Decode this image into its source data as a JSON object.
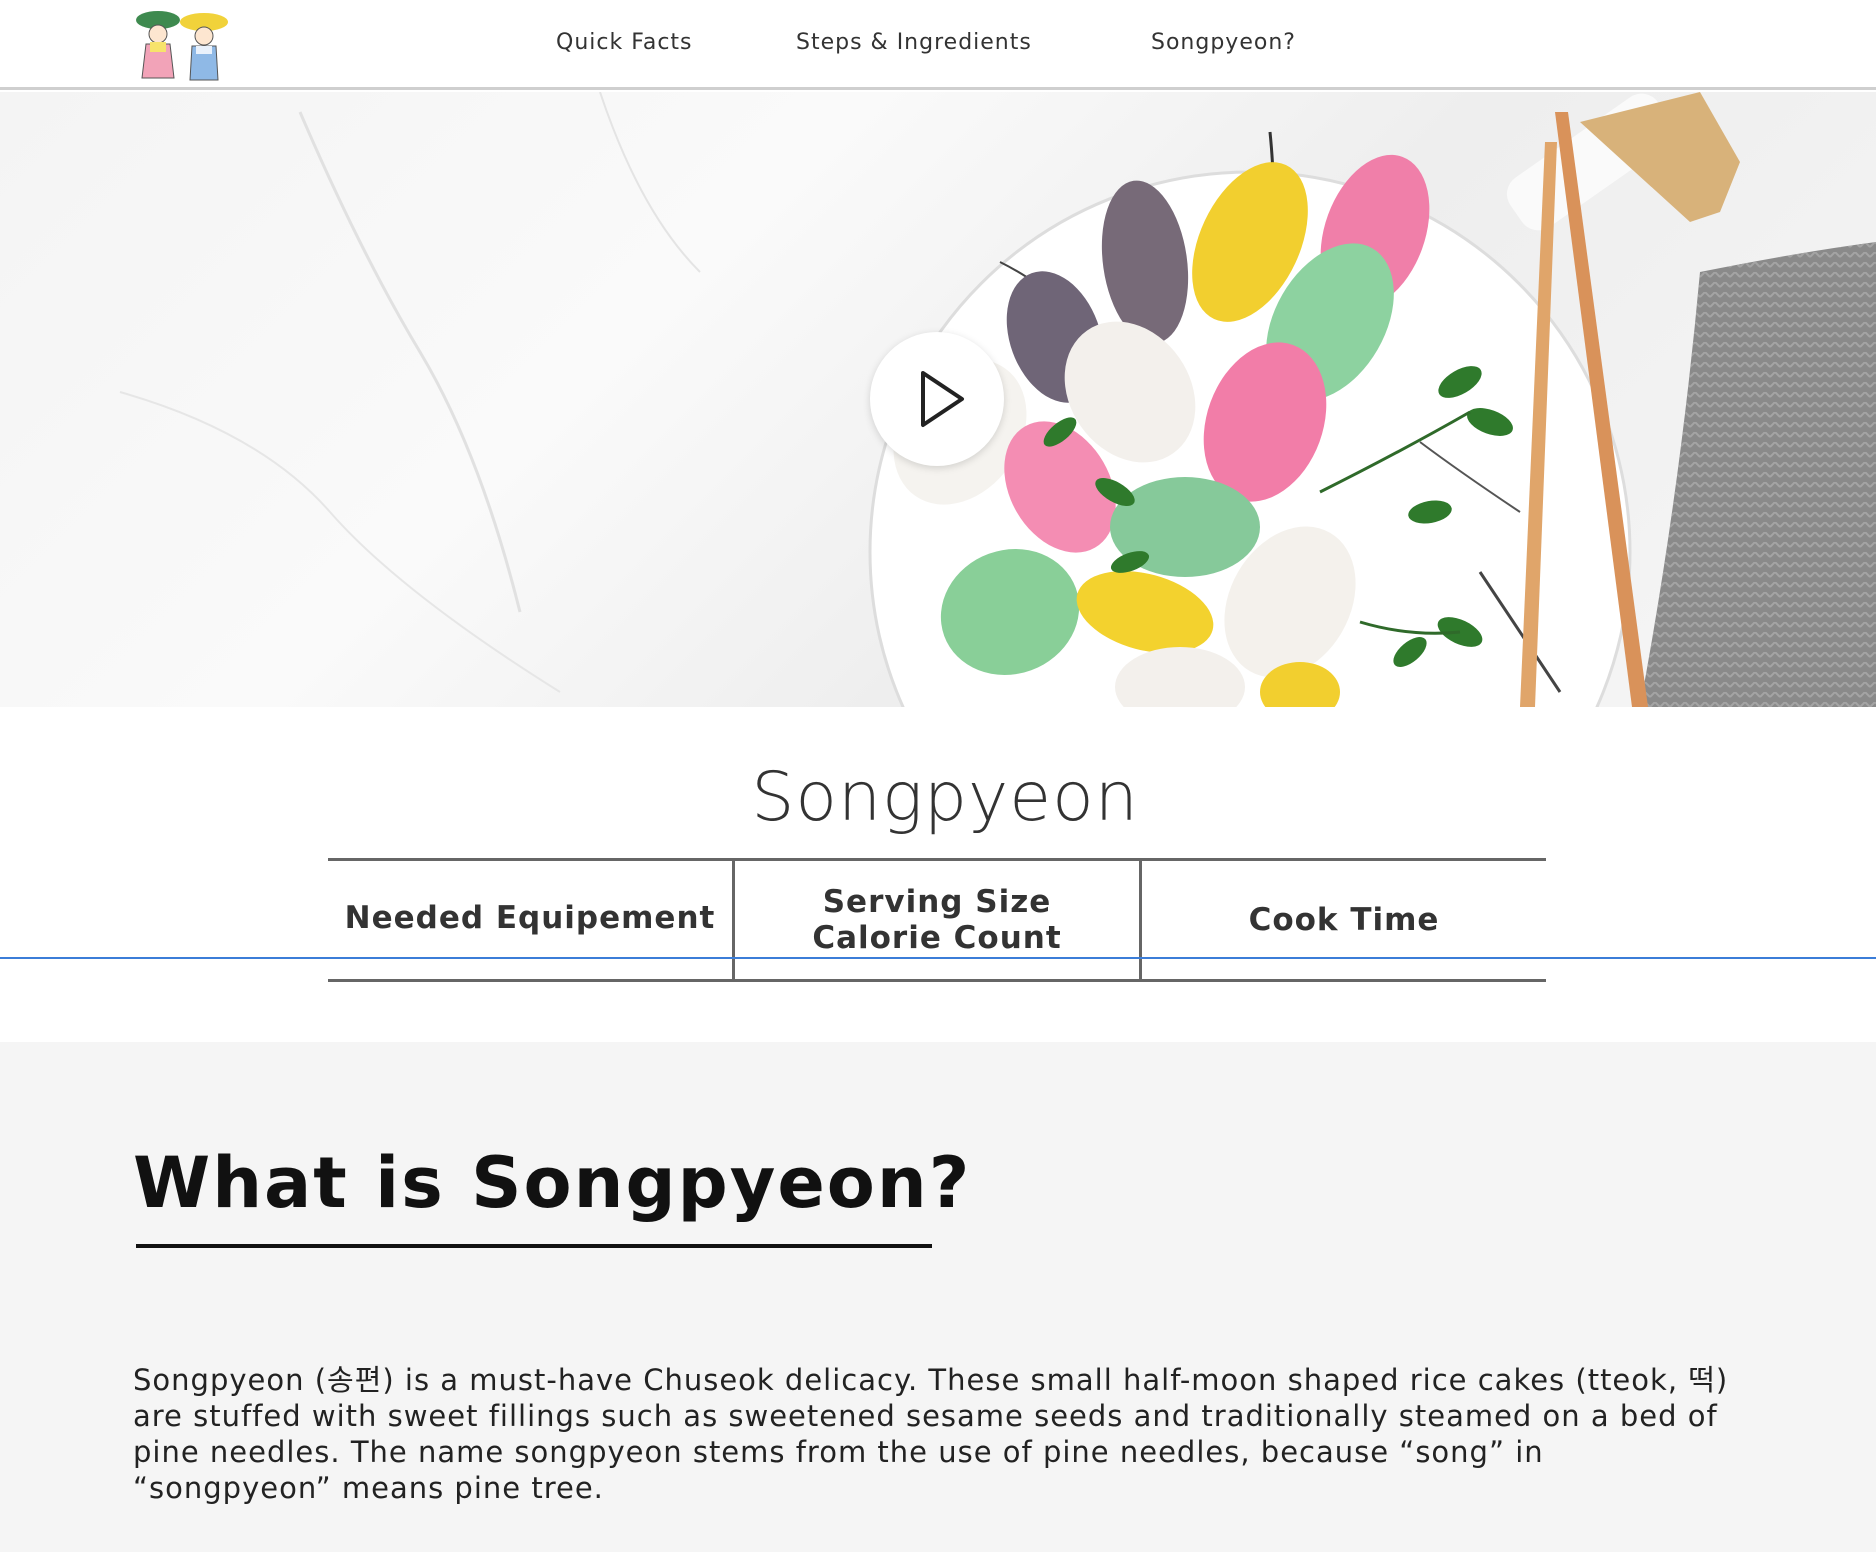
{
  "nav": {
    "links": [
      "Quick Facts",
      "Steps & Ingredients",
      "Songpyeon?"
    ]
  },
  "hero": {
    "video_action": "play-icon"
  },
  "page": {
    "title": "Songpyeon"
  },
  "info_table": {
    "equipment": "Needed Equipement",
    "serving": "Serving Size",
    "calories": "Calorie Count",
    "cook_time": "Cook Time"
  },
  "about": {
    "heading": "What is Songpyeon?",
    "paragraph": "Songpyeon (송편) is a must-have Chuseok delicacy. These small half-moon shaped rice cakes (tteok, 떡) are stuffed with sweet fillings such as sweetened sesame seeds and traditionally steamed on a bed of pine needles. The name songpyeon stems from the use of pine needles, because “song” in “songpyeon” means pine tree."
  },
  "colors": {
    "accent_line": "#3b7dd8",
    "section_bg": "#f5f5f5"
  }
}
